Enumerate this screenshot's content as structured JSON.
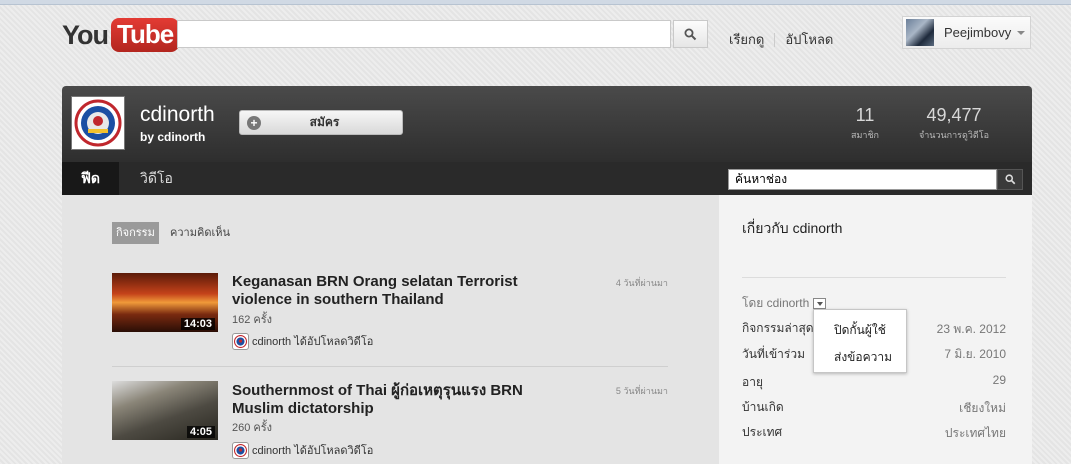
{
  "masthead": {
    "logo_you": "You",
    "logo_tube": "Tube",
    "search_value": "",
    "links": [
      "เรียกดู",
      "อัปโหลด"
    ],
    "username": "Peejimbovy"
  },
  "channel": {
    "name": "cdinorth",
    "by": "by cdinorth",
    "subscribe_label": "สมัคร",
    "stats": [
      {
        "num": "11",
        "caption": "สมาชิก"
      },
      {
        "num": "49,477",
        "caption": "จำนวนการดูวิดีโอ"
      }
    ],
    "nav": {
      "feed": "ฟีด",
      "videos": "วิดีโอ"
    },
    "search_value": "ค้นหาช่อง"
  },
  "feed": {
    "tabs": [
      "กิจกรรม",
      "ความคิดเห็น"
    ],
    "items": [
      {
        "title": "Keganasan BRN Orang selatan Terrorist violence in southern Thailand",
        "duration": "14:03",
        "views": "162 ครั้ง",
        "time": "4 วันที่ผ่านมา",
        "uploader_text": "cdinorth ได้อัปโหลดวิดีโอ"
      },
      {
        "title": "Southernmost of Thai ผู้ก่อเหตุรุนแรง BRN Muslim dictatorship",
        "duration": "4:05",
        "views": "260 ครั้ง",
        "time": "5 วันที่ผ่านมา",
        "uploader_text": "cdinorth ได้อัปโหลดวิดีโอ"
      }
    ]
  },
  "sidebar": {
    "title": "เกี่ยวกับ cdinorth",
    "by_label": "โดย cdinorth",
    "rows": [
      {
        "label": "กิจกรรมล่าสุด",
        "value": "23 พ.ค. 2012"
      },
      {
        "label": "วันที่เข้าร่วม",
        "value": "7 มิ.ย. 2010"
      },
      {
        "label": "อายุ",
        "value": "29"
      },
      {
        "label": "บ้านเกิด",
        "value": "เชียงใหม่"
      },
      {
        "label": "ประเทศ",
        "value": "ประเทศไทย"
      }
    ],
    "popup": [
      "ปิดกั้นผู้ใช้",
      "ส่งข้อความ"
    ]
  },
  "colors": {
    "logo_red": "#c4302b",
    "header_dark": "#2e2e2e"
  }
}
